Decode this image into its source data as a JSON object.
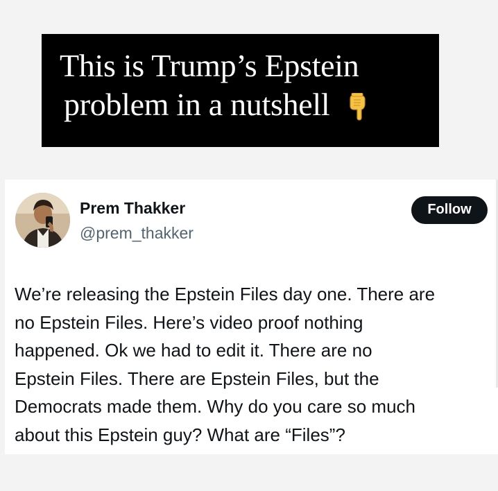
{
  "banner": {
    "line1": "This is Trump’s Epstein",
    "line2": "problem in a nutshell",
    "emoji": "backhand-index-pointing-down-icon"
  },
  "tweet": {
    "display_name": "Prem Thakker",
    "handle": "@prem_thakker",
    "follow_label": "Follow",
    "text_lines": [
      "We’re releasing the Epstein Files day one. There are",
      "no Epstein Files. Here’s video proof nothing",
      "happened. Ok we had to edit it. There are no",
      "Epstein Files. There are Epstein Files, but the",
      "Democrats made them. Why do you care so much",
      "about this Epstein guy? What are “Files”?"
    ]
  },
  "colors": {
    "banner_bg": "#000000",
    "banner_text": "#ffffff",
    "name": "#0f1419",
    "handle": "#536471",
    "follow_bg": "#0f1419",
    "page_bg": "#f3f3f3"
  }
}
